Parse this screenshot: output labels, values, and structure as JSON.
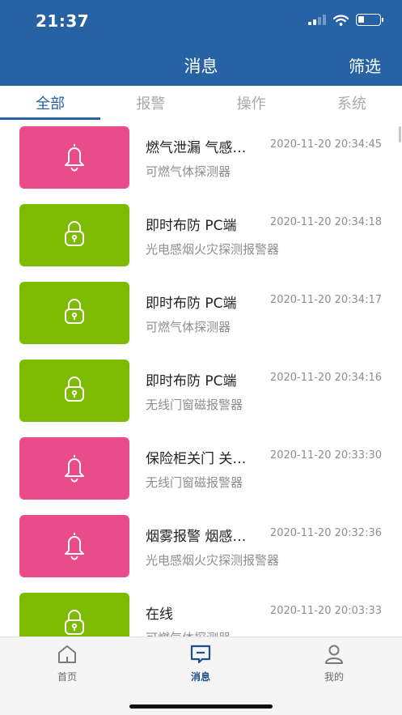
{
  "status_bar": {
    "time": "21:37"
  },
  "nav": {
    "title": "消息",
    "filter_label": "筛选"
  },
  "tabs": [
    {
      "label": "全部"
    },
    {
      "label": "报警"
    },
    {
      "label": "操作"
    },
    {
      "label": "系统"
    }
  ],
  "messages": [
    {
      "type": "alarm",
      "icon": "bell-icon",
      "title": "燃气泄漏  气感…",
      "time": "2020-11-20 20:34:45",
      "device": "可燃气体探测器"
    },
    {
      "type": "operation",
      "icon": "lock-icon",
      "title": "即时布防   PC端",
      "time": "2020-11-20 20:34:18",
      "device": "光电感烟火灾探测报警器"
    },
    {
      "type": "operation",
      "icon": "lock-icon",
      "title": "即时布防   PC端",
      "time": "2020-11-20 20:34:17",
      "device": "可燃气体探测器"
    },
    {
      "type": "operation",
      "icon": "lock-icon",
      "title": "即时布防   PC端",
      "time": "2020-11-20 20:34:16",
      "device": "无线门窗磁报警器"
    },
    {
      "type": "alarm",
      "icon": "bell-icon",
      "title": "保险柜关门  关…",
      "time": "2020-11-20 20:33:30",
      "device": "无线门窗磁报警器"
    },
    {
      "type": "alarm",
      "icon": "bell-icon",
      "title": "烟雾报警  烟感…",
      "time": "2020-11-20 20:32:36",
      "device": "光电感烟火灾探测报警器"
    },
    {
      "type": "operation",
      "icon": "lock-icon",
      "title": "在线",
      "time": "2020-11-20 20:03:33",
      "device": "可燃气体探测器"
    }
  ],
  "bottom_nav": {
    "home_label": "首页",
    "messages_label": "消息",
    "mine_label": "我的"
  },
  "colors": {
    "primary": "#2762a4",
    "alarm": "#ea4b8a",
    "operation": "#7cbb00"
  }
}
